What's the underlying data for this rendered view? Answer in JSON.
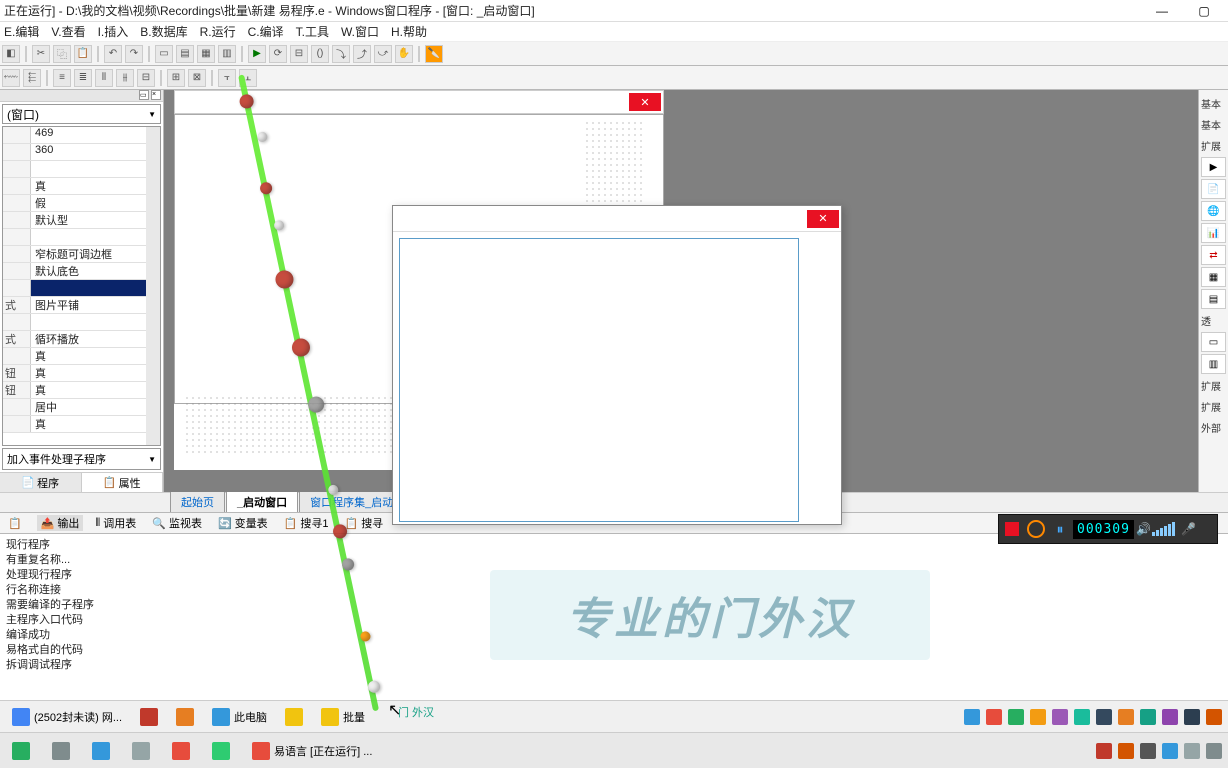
{
  "title": "正在运行] - D:\\我的文档\\视频\\Recordings\\批量\\新建 易程序.e - Windows窗口程序 - [窗口: _启动窗口]",
  "menu": [
    "E.编辑",
    "V.查看",
    "I.插入",
    "B.数据库",
    "R.运行",
    "C.编译",
    "T.工具",
    "W.窗口",
    "H.帮助"
  ],
  "prop_combo": "(窗口)",
  "props": [
    {
      "l": "",
      "v": "469"
    },
    {
      "l": "",
      "v": "360"
    },
    {
      "l": "",
      "v": ""
    },
    {
      "l": "",
      "v": "真"
    },
    {
      "l": "",
      "v": "假"
    },
    {
      "l": "",
      "v": "默认型"
    },
    {
      "l": "",
      "v": ""
    },
    {
      "l": "",
      "v": "窄标题可调边框"
    },
    {
      "l": "",
      "v": "默认底色"
    },
    {
      "l": "",
      "v": "",
      "sel": true
    },
    {
      "l": "式",
      "v": "图片平铺"
    },
    {
      "l": "",
      "v": ""
    },
    {
      "l": "式",
      "v": "循环播放"
    },
    {
      "l": "",
      "v": "真"
    },
    {
      "l": "钮",
      "v": "真"
    },
    {
      "l": "钮",
      "v": "真"
    },
    {
      "l": "",
      "v": "居中"
    },
    {
      "l": "",
      "v": "真"
    }
  ],
  "prop_bottom": "加入事件处理子程序",
  "left_tabs": {
    "a": "程序",
    "b": "属性"
  },
  "design_tabs": [
    "起始页",
    "_启动窗口",
    "窗口程序集_启动"
  ],
  "output_tabs": [
    "",
    "输出",
    "调用表",
    "监视表",
    "变量表",
    "搜寻1",
    "搜寻"
  ],
  "icons": [
    "🗐",
    "",
    "|||",
    "🔍",
    "🔃",
    "📋",
    "🔎"
  ],
  "output_lines": [
    "现行程序",
    "有重复名称...",
    "处理现行程序",
    "行名称连接",
    "需要编译的子程序",
    "",
    "主程序入口代码",
    "编译成功",
    "易格式自的代码",
    "拆调调试程序"
  ],
  "recorder_time": "000309",
  "watermark": "专业的门外汉",
  "task1": [
    {
      "t": "(2502封未读) 网...",
      "c": "#4285f4"
    },
    {
      "t": "",
      "c": "#c0392b"
    },
    {
      "t": "",
      "c": "#e67e22"
    },
    {
      "t": "此电脑",
      "c": "#3498db"
    },
    {
      "t": "",
      "c": "#f1c40f"
    },
    {
      "t": "批量",
      "c": "#f1c40f"
    }
  ],
  "task2": [
    {
      "t": "",
      "c": "#27ae60"
    },
    {
      "t": "",
      "c": "#7f8c8d"
    },
    {
      "t": "",
      "c": "#3498db"
    },
    {
      "t": "",
      "c": "#95a5a6"
    },
    {
      "t": "",
      "c": "#e74c3c"
    },
    {
      "t": "",
      "c": "#2ecc71"
    },
    {
      "t": "易语言 [正在运行] ...",
      "c": "#e74c3c"
    }
  ],
  "right_labels": [
    "基本",
    "基本",
    "扩展",
    "透",
    "扩展",
    "扩展",
    "外部"
  ],
  "cursor_label": "门\n外汉"
}
